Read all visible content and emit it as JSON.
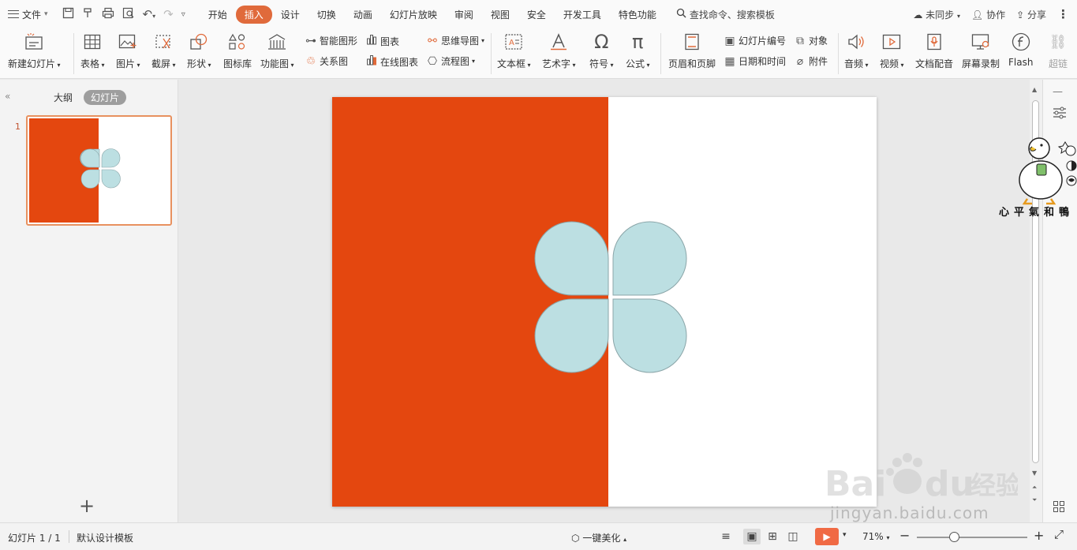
{
  "menubar": {
    "file_label": "文件",
    "tabs": [
      {
        "label": "开始"
      },
      {
        "label": "插入"
      },
      {
        "label": "设计"
      },
      {
        "label": "切换"
      },
      {
        "label": "动画"
      },
      {
        "label": "幻灯片放映"
      },
      {
        "label": "审阅"
      },
      {
        "label": "视图"
      },
      {
        "label": "安全"
      },
      {
        "label": "开发工具"
      },
      {
        "label": "特色功能"
      }
    ],
    "active_tab": "插入",
    "search_label": "查找命令、搜索模板",
    "sync_label": "未同步",
    "collab_label": "协作",
    "share_label": "分享"
  },
  "ribbon": {
    "new_slide": "新建幻灯片",
    "table": "表格",
    "picture": "图片",
    "screenshot": "截屏",
    "shape": "形状",
    "icon_lib": "图标库",
    "func_chart": "功能图",
    "smart_shape": "智能图形",
    "chart": "图表",
    "relation": "关系图",
    "online_chart": "在线图表",
    "mindmap": "思维导图",
    "flowchart": "流程图",
    "textbox": "文本框",
    "wordart": "艺术字",
    "symbol": "符号",
    "formula": "公式",
    "header_footer": "页眉和页脚",
    "slide_number": "幻灯片编号",
    "object": "对象",
    "datetime": "日期和时间",
    "attachment": "附件",
    "audio": "音频",
    "video": "视频",
    "doc_dub": "文档配音",
    "screen_record": "屏幕录制",
    "flash": "Flash",
    "hyperlink": "超链"
  },
  "leftpanel": {
    "outline_tab": "大纲",
    "slides_tab": "幻灯片",
    "slide_number": "1"
  },
  "slide": {
    "background_left": "#e4470f",
    "petal_color": "#bcdfe2"
  },
  "sidebar": {
    "duck_caption": "心平氣和鴨"
  },
  "statusbar": {
    "slide_info": "幻灯片 1 / 1",
    "template": "默认设计模板",
    "beautify": "一键美化",
    "zoom": "71%"
  },
  "watermark": {
    "text": "jingyan.baidu.com"
  }
}
